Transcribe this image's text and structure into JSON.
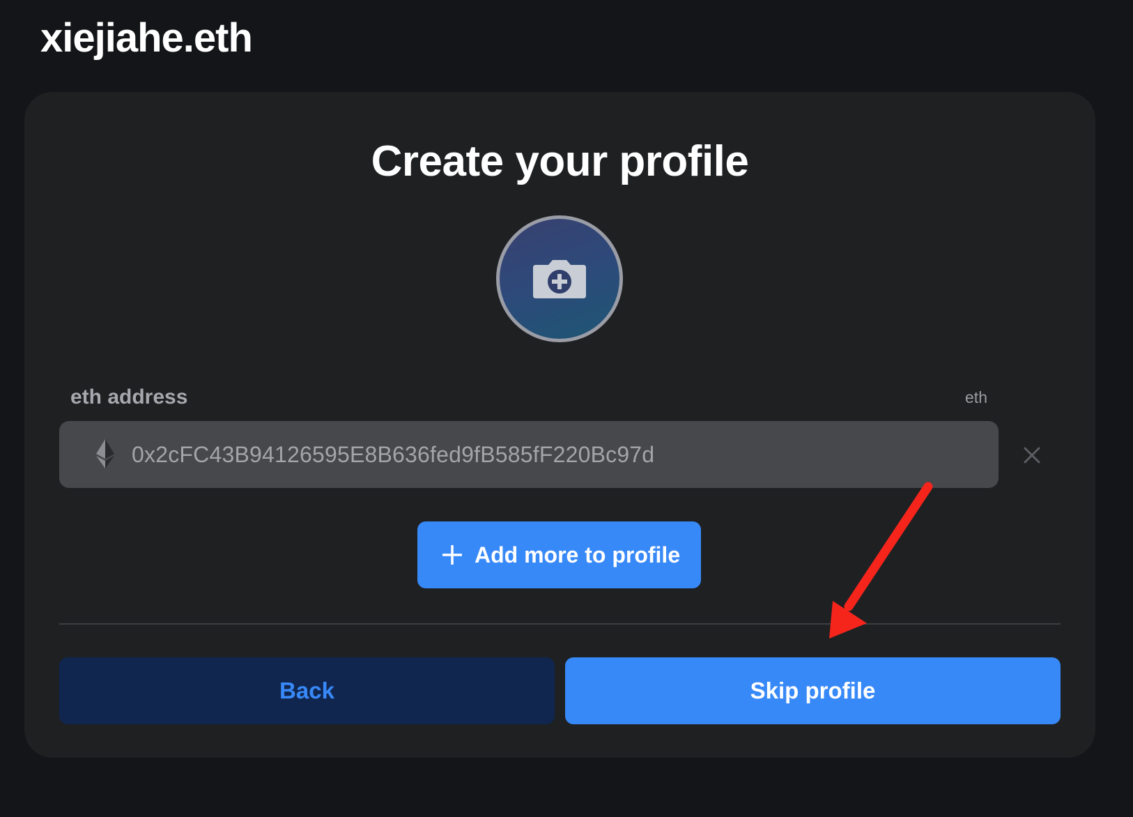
{
  "site": {
    "name": "xiejiahe.eth"
  },
  "card": {
    "title": "Create your profile",
    "avatar": {
      "icon": "camera-plus-icon"
    },
    "field": {
      "label": "eth address",
      "hint": "eth",
      "icon": "ethereum-icon",
      "value": "0x2cFC43B94126595E8B636fed9fB585fF220Bc97d",
      "remove_icon": "close-icon"
    },
    "add_more": {
      "icon": "plus-icon",
      "label": "Add more to profile"
    },
    "back_label": "Back",
    "skip_label": "Skip profile"
  },
  "colors": {
    "background": "#141518",
    "card": "#1e2022",
    "primary": "#3889f8",
    "back_bg": "#10264f",
    "input_bg": "#47484c",
    "annotation": "#f5251c"
  }
}
